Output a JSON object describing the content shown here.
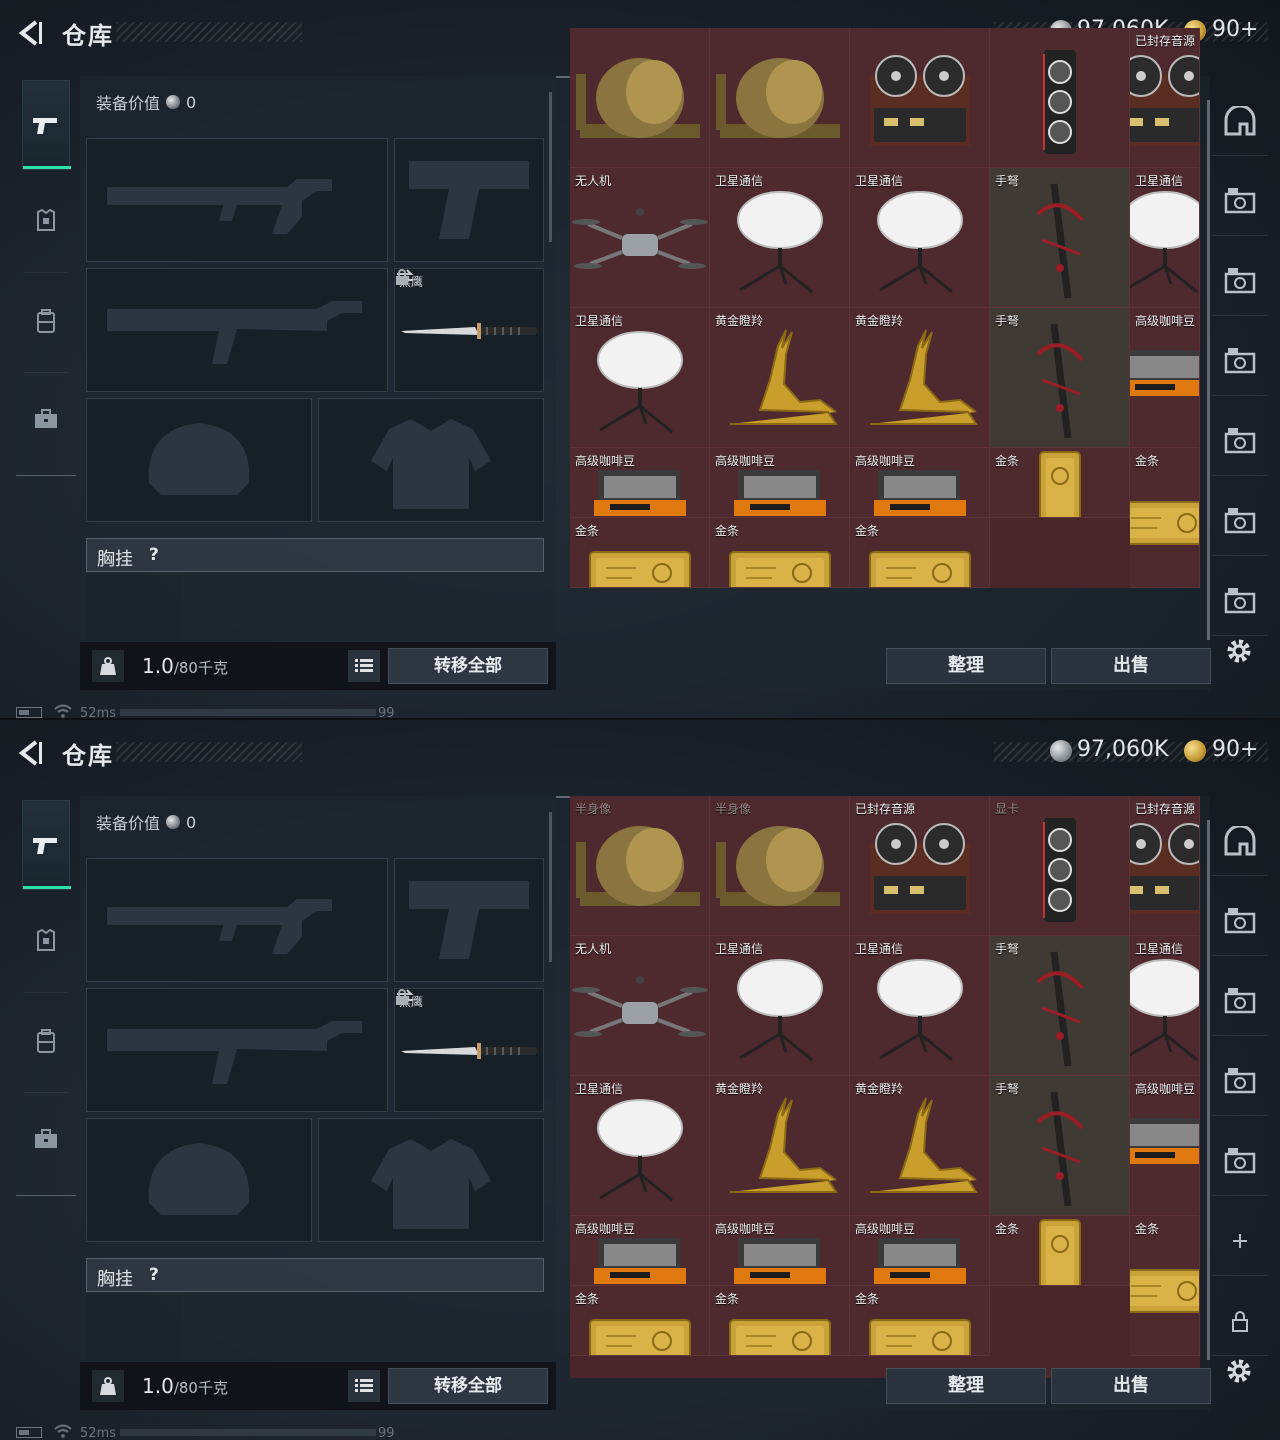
{
  "header": {
    "title": "仓库",
    "silver": "97,060K",
    "gold": "90+"
  },
  "equipment": {
    "value_label": "装备价值",
    "value": "0",
    "knife_name": "黑鹰",
    "chest_rig_label": "胸挂",
    "chest_rig_help": "?",
    "weight": "1.0",
    "weight_max": "/80千克",
    "transfer_all": "转移全部"
  },
  "actions": {
    "sort": "整理",
    "sell": "出售"
  },
  "status": {
    "ping": "52ms",
    "fps": "99"
  },
  "screen1_items": [
    {
      "label": "",
      "icon": "bust",
      "col": 0,
      "row": 0,
      "w": 2,
      "h": 1,
      "partial": true
    },
    {
      "label": "",
      "icon": "bust",
      "col": 1.5,
      "row": 0,
      "w": 2,
      "h": 1,
      "partial": true
    },
    {
      "label": "",
      "icon": "reel",
      "col": 3,
      "row": 0,
      "w": 2,
      "h": 1,
      "partial": true
    },
    {
      "label": "",
      "icon": "gpu",
      "col": 4,
      "row": 0,
      "w": 1,
      "h": 1,
      "partial": true
    },
    {
      "label": "已封存音源",
      "icon": "reel"
    },
    {
      "label": "无人机",
      "icon": "drone"
    },
    {
      "label": "卫星通信",
      "icon": "dish"
    },
    {
      "label": "卫星通信",
      "icon": "dish"
    },
    {
      "label": "手弩",
      "icon": "crossbow"
    },
    {
      "label": "卫星通信",
      "icon": "dish"
    },
    {
      "label": "卫星通信",
      "icon": "dish"
    },
    {
      "label": "黄金瞪羚",
      "icon": "gazelle"
    },
    {
      "label": "黄金瞪羚",
      "icon": "gazelle"
    },
    {
      "label": "手弩",
      "icon": "crossbow"
    },
    {
      "label": "高级咖啡豆",
      "icon": "coffee"
    },
    {
      "label": "高级咖啡豆",
      "icon": "coffee"
    },
    {
      "label": "高级咖啡豆",
      "icon": "coffee"
    },
    {
      "label": "高级咖啡豆",
      "icon": "coffee"
    },
    {
      "label": "金条",
      "icon": "goldbar-v"
    },
    {
      "label": "金条",
      "icon": "goldbar"
    },
    {
      "label": "金条",
      "icon": "goldbar"
    },
    {
      "label": "金条",
      "icon": "goldbar"
    },
    {
      "label": "金条",
      "icon": "goldbar"
    }
  ],
  "screen2_items": [
    {
      "label": "半身像",
      "icon": "bust"
    },
    {
      "label": "半身像",
      "icon": "bust"
    },
    {
      "label": "已封存音源",
      "icon": "reel"
    },
    {
      "label": "显卡",
      "icon": "gpu"
    },
    {
      "label": "已封存音源",
      "icon": "reel"
    },
    {
      "label": "无人机",
      "icon": "drone"
    },
    {
      "label": "卫星通信",
      "icon": "dish"
    },
    {
      "label": "卫星通信",
      "icon": "dish"
    },
    {
      "label": "手弩",
      "icon": "crossbow"
    },
    {
      "label": "卫星通信",
      "icon": "dish"
    },
    {
      "label": "卫星通信",
      "icon": "dish"
    },
    {
      "label": "黄金瞪羚",
      "icon": "gazelle"
    },
    {
      "label": "黄金瞪羚",
      "icon": "gazelle"
    },
    {
      "label": "手弩",
      "icon": "crossbow"
    },
    {
      "label": "高级咖啡豆",
      "icon": "coffee"
    },
    {
      "label": "高级咖啡豆",
      "icon": "coffee"
    },
    {
      "label": "高级咖啡豆",
      "icon": "coffee"
    },
    {
      "label": "高级咖啡豆",
      "icon": "coffee"
    },
    {
      "label": "金条",
      "icon": "goldbar-v"
    },
    {
      "label": "金条",
      "icon": "goldbar"
    },
    {
      "label": "金条",
      "icon": "goldbar"
    },
    {
      "label": "金条",
      "icon": "goldbar"
    },
    {
      "label": "金条",
      "icon": "goldbar"
    }
  ],
  "colors": {
    "accent": "#2fe0a6",
    "grid_bg": "#4e2a2f",
    "gold": "#c9a23a"
  }
}
